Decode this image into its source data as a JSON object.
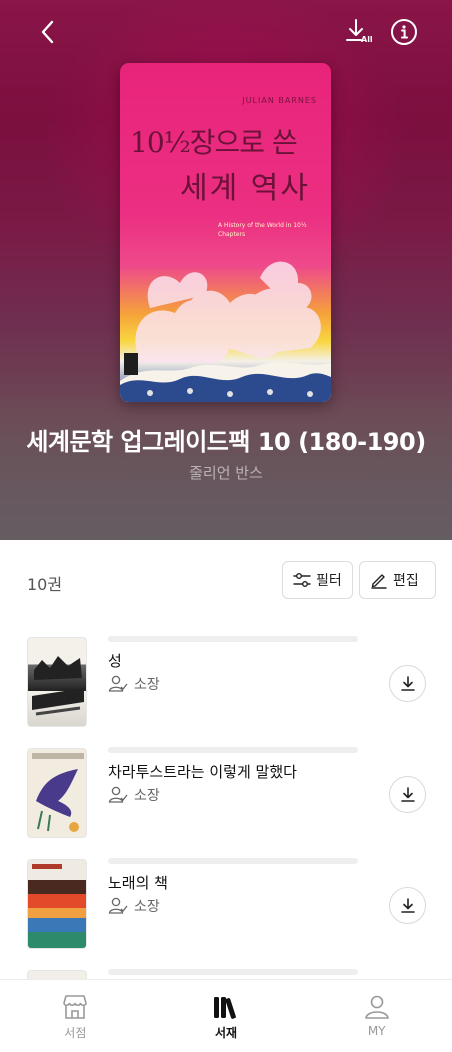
{
  "header": {
    "back_icon": "chevron-left-icon",
    "download_all_icon": "download-all-icon",
    "download_all_badge": "All",
    "info_icon": "info-icon"
  },
  "pack": {
    "title": "세계문학 업그레이드팩 10 (180-190)",
    "author": "줄리언 반스",
    "cover": {
      "author_text": "JULIAN BARNES",
      "title_line1": "10½장으로 쓴",
      "title_line2": "세계 역사",
      "subtitle": "A History of the World in 10½ Chapters",
      "accent": "#e8247a"
    }
  },
  "toolbar": {
    "count": "10권",
    "filter_label": "필터",
    "edit_label": "편집"
  },
  "books": [
    {
      "title": "성",
      "owned_label": "소장",
      "cover_colors": [
        "#f3f1ea",
        "#222222",
        "#6b6b6b"
      ]
    },
    {
      "title": "차라투스트라는 이렇게 말했다",
      "owned_label": "소장",
      "cover_colors": [
        "#f1ecdf",
        "#4a3a8c",
        "#e8a640"
      ]
    },
    {
      "title": "노래의 책",
      "owned_label": "소장",
      "cover_colors": [
        "#f0ebe2",
        "#e24a2a",
        "#3a78b8"
      ]
    }
  ],
  "nav": {
    "items": [
      {
        "label": "서점",
        "icon": "store-icon",
        "active": false
      },
      {
        "label": "서재",
        "icon": "library-icon",
        "active": true
      },
      {
        "label": "MY",
        "icon": "user-icon",
        "active": false
      }
    ]
  }
}
